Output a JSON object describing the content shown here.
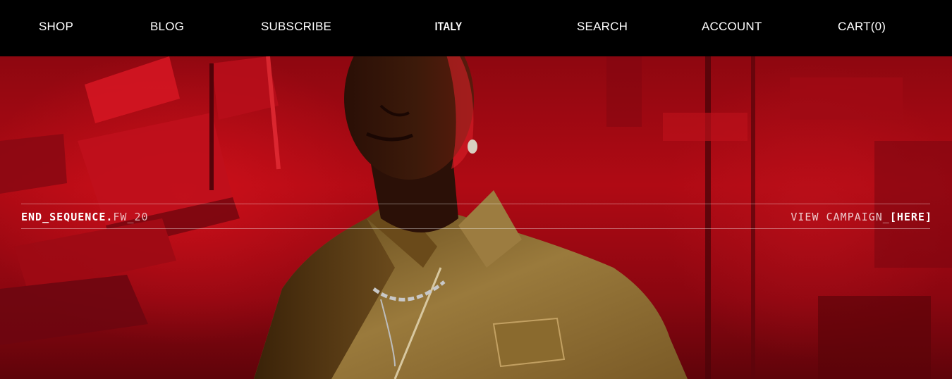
{
  "nav": {
    "shop": "SHOP",
    "blog": "BLOG",
    "subscribe": "SUBSCRIBE",
    "logo": "ITALY",
    "search": "SEARCH",
    "account": "ACCOUNT",
    "cart": "CART(0)"
  },
  "hero": {
    "sequence_main": "END_SEQUENCE.",
    "sequence_suffix": "FW_20",
    "campaign_prefix": "VIEW CAMPAIGN_",
    "campaign_link": "[HERE]"
  },
  "colors": {
    "nav_background": "#000000",
    "hero_red": "#b00a14",
    "text": "#ffffff"
  }
}
